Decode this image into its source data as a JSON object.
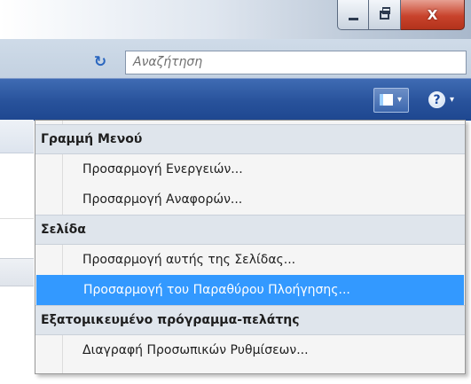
{
  "window": {
    "minimize_icon": "minimize-icon",
    "maximize_icon": "restore-icon",
    "close_icon": "close-icon",
    "close_glyph": "X"
  },
  "toolbar": {
    "refresh_icon": "refresh-icon",
    "refresh_glyph": "↻",
    "search_placeholder": "Αναζήτηση"
  },
  "commandbar": {
    "layout_icon": "layout-icon",
    "layout_arrow": "▾",
    "help_icon": "help-icon",
    "help_glyph": "?",
    "help_arrow": "▾"
  },
  "menu": {
    "sections": [
      {
        "header": "Γραμμή Μενού",
        "items": [
          {
            "label": "Προσαρμογή Ενεργειών..."
          },
          {
            "label": "Προσαρμογή Αναφορών..."
          }
        ]
      },
      {
        "header": "Σελίδα",
        "items": [
          {
            "label": "Προσαρμογή αυτής της Σελίδας..."
          },
          {
            "label": "Προσαρμογή του Παραθύρου Πλοήγησης..."
          }
        ]
      },
      {
        "header": "Εξατομικευμένο πρόγραμμα-πελάτης",
        "items": [
          {
            "label": "Διαγραφή Προσωπικών Ρυθμίσεων..."
          }
        ]
      }
    ],
    "highlighted_item": "Προσαρμογή του Παραθύρου Πλοήγησης...",
    "highlight_color": "#3399ff"
  }
}
